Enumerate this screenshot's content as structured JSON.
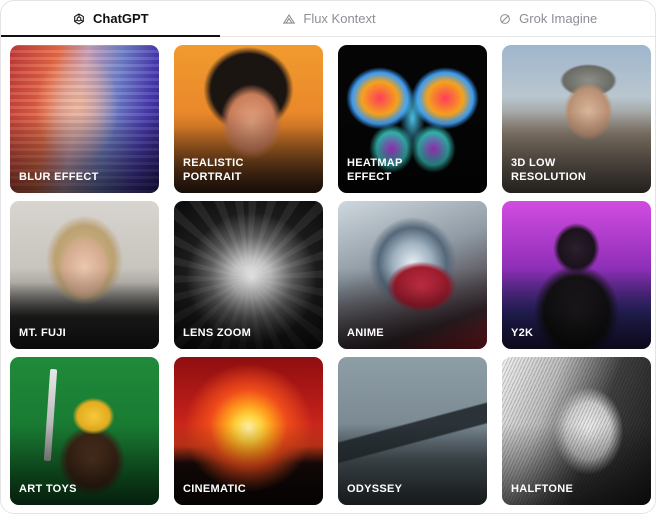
{
  "tabs": [
    {
      "label": "ChatGPT",
      "icon": "openai-icon",
      "active": true
    },
    {
      "label": "Flux Kontext",
      "icon": "flux-icon",
      "active": false
    },
    {
      "label": "Grok Imagine",
      "icon": "grok-icon",
      "active": false
    }
  ],
  "styles": [
    {
      "label": "BLUR EFFECT",
      "name": "style-card-blur-effect"
    },
    {
      "label": "REALISTIC\nPORTRAIT",
      "name": "style-card-realistic-portrait"
    },
    {
      "label": "HEATMAP\nEFFECT",
      "name": "style-card-heatmap-effect"
    },
    {
      "label": "3D LOW\nRESOLUTION",
      "name": "style-card-3d-low-resolution"
    },
    {
      "label": "MT. FUJI",
      "name": "style-card-mt-fuji"
    },
    {
      "label": "LENS ZOOM",
      "name": "style-card-lens-zoom"
    },
    {
      "label": "ANIME",
      "name": "style-card-anime"
    },
    {
      "label": "Y2K",
      "name": "style-card-y2k"
    },
    {
      "label": "ART TOYS",
      "name": "style-card-art-toys"
    },
    {
      "label": "CINEMATIC",
      "name": "style-card-cinematic"
    },
    {
      "label": "ODYSSEY",
      "name": "style-card-odyssey"
    },
    {
      "label": "HALFTONE",
      "name": "style-card-halftone"
    }
  ],
  "colors": {
    "active_tab": "#111111",
    "inactive_tab": "#8e8e96",
    "divider": "#e6e6e9"
  }
}
